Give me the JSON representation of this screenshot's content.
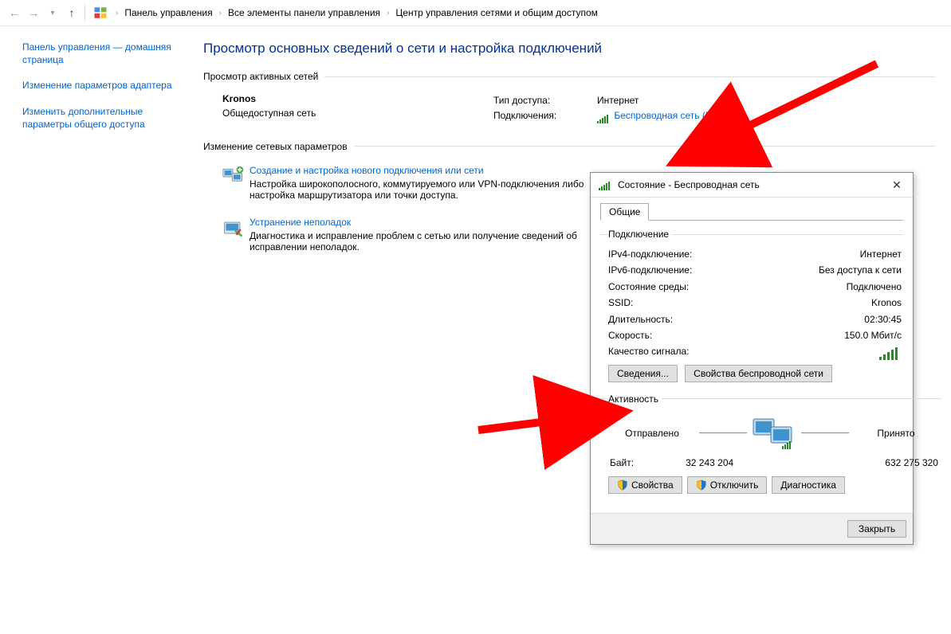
{
  "breadcrumb": {
    "a": "Панель управления",
    "b": "Все элементы панели управления",
    "c": "Центр управления сетями и общим доступом"
  },
  "side": {
    "home": "Панель управления — домашняя страница",
    "adapter": "Изменение параметров адаптера",
    "sharing": "Изменить дополнительные параметры общего доступа"
  },
  "title": "Просмотр основных сведений о сети и настройка подключений",
  "active_hdr": "Просмотр активных сетей",
  "net": {
    "name": "Kronos",
    "type": "Общедоступная сеть",
    "access_lbl": "Тип доступа:",
    "access_val": "Интернет",
    "conn_lbl": "Подключения:",
    "conn_link": "Беспроводная сеть (Kronos)"
  },
  "change_hdr": "Изменение сетевых параметров",
  "task1": {
    "link": "Создание и настройка нового подключения или сети",
    "desc": "Настройка широкополосного, коммутируемого или VPN-подключения либо настройка маршрутизатора или точки доступа."
  },
  "task2": {
    "link": "Устранение неполадок",
    "desc": "Диагностика и исправление проблем с сетью или получение сведений об исправлении неполадок."
  },
  "dlg": {
    "title": "Состояние - Беспроводная сеть",
    "tab": "Общие",
    "grp_conn": "Подключение",
    "ipv4_k": "IPv4-подключение:",
    "ipv4_v": "Интернет",
    "ipv6_k": "IPv6-подключение:",
    "ipv6_v": "Без доступа к сети",
    "media_k": "Состояние среды:",
    "media_v": "Подключено",
    "ssid_k": "SSID:",
    "ssid_v": "Kronos",
    "dur_k": "Длительность:",
    "dur_v": "02:30:45",
    "speed_k": "Скорость:",
    "speed_v": "150.0 Мбит/с",
    "sigq_k": "Качество сигнала:",
    "btn_details": "Сведения...",
    "btn_wprops": "Свойства беспроводной сети",
    "grp_act": "Активность",
    "sent": "Отправлено",
    "recv": "Принято",
    "bytes_lbl": "Байт:",
    "sent_b": "32 243 204",
    "recv_b": "632 275 320",
    "btn_props": "Свойства",
    "btn_disc": "Отключить",
    "btn_diag": "Диагностика",
    "btn_close": "Закрыть"
  }
}
